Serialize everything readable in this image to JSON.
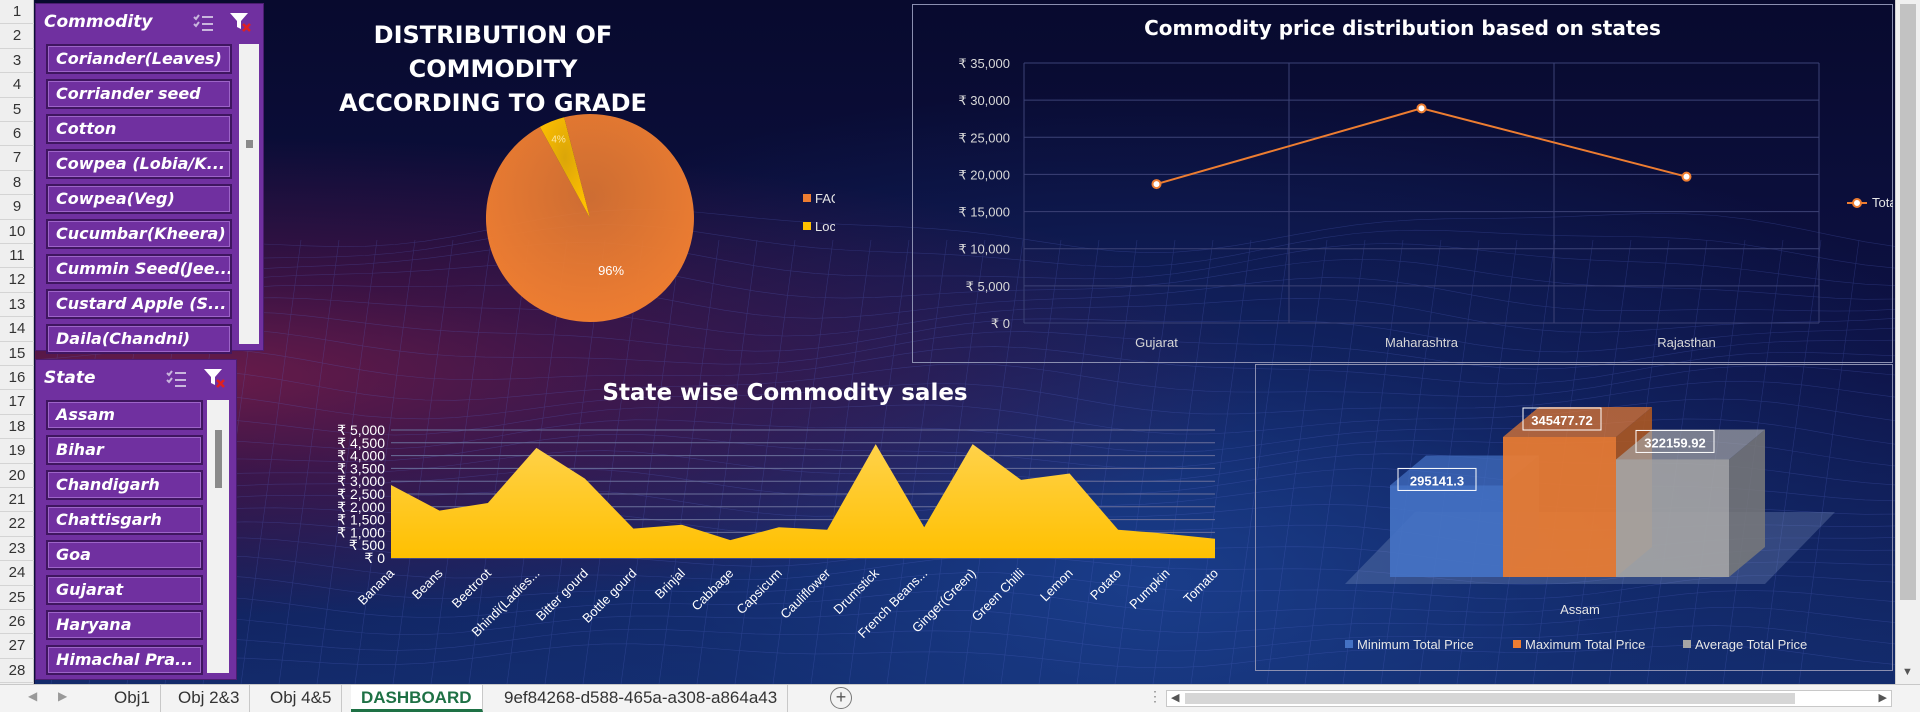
{
  "rows": [
    "1",
    "2",
    "3",
    "4",
    "5",
    "6",
    "7",
    "8",
    "9",
    "10",
    "11",
    "12",
    "13",
    "14",
    "15",
    "16",
    "17",
    "18",
    "19",
    "20",
    "21",
    "22",
    "23",
    "24",
    "25",
    "26",
    "27",
    "28"
  ],
  "slicers": {
    "commodity": {
      "title": "Commodity",
      "items": [
        "Coriander(Leaves)",
        "Corriander seed",
        "Cotton",
        "Cowpea (Lobia/K...",
        "Cowpea(Veg)",
        "Cucumbar(Kheera)",
        "Cummin Seed(Jee...",
        "Custard Apple (S...",
        "Daila(Chandni)"
      ]
    },
    "state": {
      "title": "State",
      "items": [
        "Assam",
        "Bihar",
        "Chandigarh",
        "Chattisgarh",
        "Goa",
        "Gujarat",
        "Haryana",
        "Himachal Pra..."
      ]
    }
  },
  "colors": {
    "purple": "#7030a0",
    "orange": "#ed7d31",
    "gold": "#ffc000",
    "blue": "#4472c4",
    "gray": "#a5a5a5"
  },
  "chart_data": [
    {
      "type": "pie",
      "title": "DISTRIBUTION OF COMMODITY ACCORDING TO GRADE",
      "title_lines": [
        "DISTRIBUTION OF COMMODITY",
        "ACCORDING TO GRADE"
      ],
      "slices": [
        {
          "name": "FAQ",
          "value": 96,
          "label": "96%",
          "color": "#ed7d31"
        },
        {
          "name": "Local",
          "value": 4,
          "label": "4%",
          "color": "#ffc000"
        }
      ],
      "legend": "right"
    },
    {
      "type": "line",
      "title": "Commodity price distribution based on states",
      "categories": [
        "Gujarat",
        "Maharashtra",
        "Rajasthan"
      ],
      "series": [
        {
          "name": "Total",
          "values": [
            18700,
            28900,
            19700
          ],
          "color": "#ed7d31"
        }
      ],
      "yticks": [
        "₹ 0",
        "₹ 5,000",
        "₹ 10,000",
        "₹ 15,000",
        "₹ 20,000",
        "₹ 25,000",
        "₹ 30,000",
        "₹ 35,000"
      ],
      "ylim": [
        0,
        35000
      ],
      "grid": true,
      "legend": "right"
    },
    {
      "type": "area",
      "title": "State wise Commodity sales",
      "categories": [
        "Banana",
        "Beans",
        "Beetroot",
        "Bhindi(Ladies...",
        "Bitter gourd",
        "Bottle gourd",
        "Brinjal",
        "Cabbage",
        "Capsicum",
        "Cauliflower",
        "Drumstick",
        "French Beans...",
        "Ginger(Green)",
        "Green Chilli",
        "Lemon",
        "Potato",
        "Pumpkin",
        "Tomato"
      ],
      "values": [
        2850,
        1850,
        2150,
        4300,
        3100,
        1150,
        1300,
        700,
        1200,
        1100,
        4450,
        1200,
        4450,
        3050,
        3300,
        1100,
        950,
        750
      ],
      "yticks": [
        "₹ 0",
        "₹ 500",
        "₹ 1,000",
        "₹ 1,500",
        "₹ 2,000",
        "₹ 2,500",
        "₹ 3,000",
        "₹ 3,500",
        "₹ 4,000",
        "₹ 4,500",
        "₹ 5,000"
      ],
      "ylim": [
        0,
        5000
      ],
      "grid": true,
      "color": "#ffc000"
    },
    {
      "type": "bar",
      "title": "",
      "categories": [
        "Assam"
      ],
      "series": [
        {
          "name": "Minimum Total Price",
          "values": [
            295141.3
          ],
          "label": "295141.3",
          "color": "#4472c4"
        },
        {
          "name": "Maximum Total Price",
          "values": [
            345477.72
          ],
          "label": "345477.72",
          "color": "#ed7d31"
        },
        {
          "name": "Average Total Price",
          "values": [
            322159.92
          ],
          "label": "322159.92",
          "color": "#a5a5a5"
        }
      ],
      "legend": "bottom"
    }
  ],
  "tabs": [
    "Obj1",
    "Obj 2&3",
    "Obj 4&5",
    "DASHBOARD",
    "9ef84268-d588-465a-a308-a864a43"
  ],
  "active_tab": "DASHBOARD"
}
